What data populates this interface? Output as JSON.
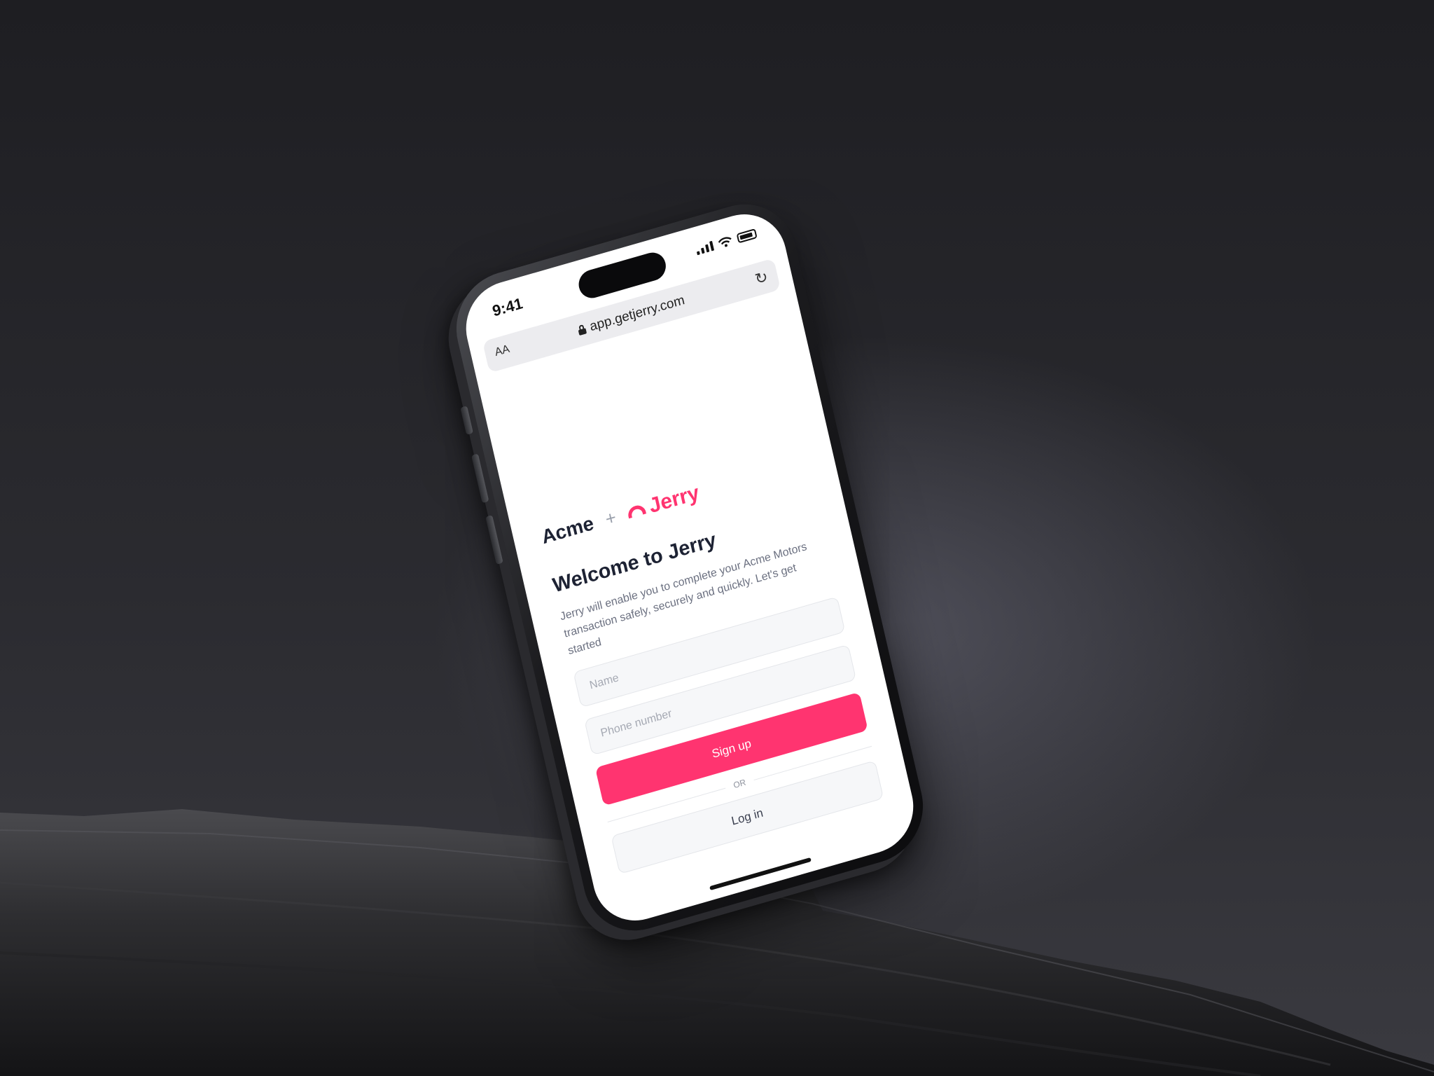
{
  "status_bar": {
    "time": "9:41"
  },
  "browser": {
    "text_size_label": "AA",
    "url": "app.getjerry.com",
    "lock_icon": "lock-icon",
    "reload_icon": "reload-icon"
  },
  "brand": {
    "partner": "Acme",
    "plus": "+",
    "name": "Jerry",
    "accent_color": "#ff3470"
  },
  "welcome": {
    "title": "Welcome to Jerry",
    "description": "Jerry will enable you to complete your Acme Motors transaction safely, securely and quickly.  Let's get started"
  },
  "form": {
    "name_placeholder": "Name",
    "phone_placeholder": "Phone number",
    "signup_label": "Sign up",
    "or_label": "OR",
    "login_label": "Log in"
  }
}
